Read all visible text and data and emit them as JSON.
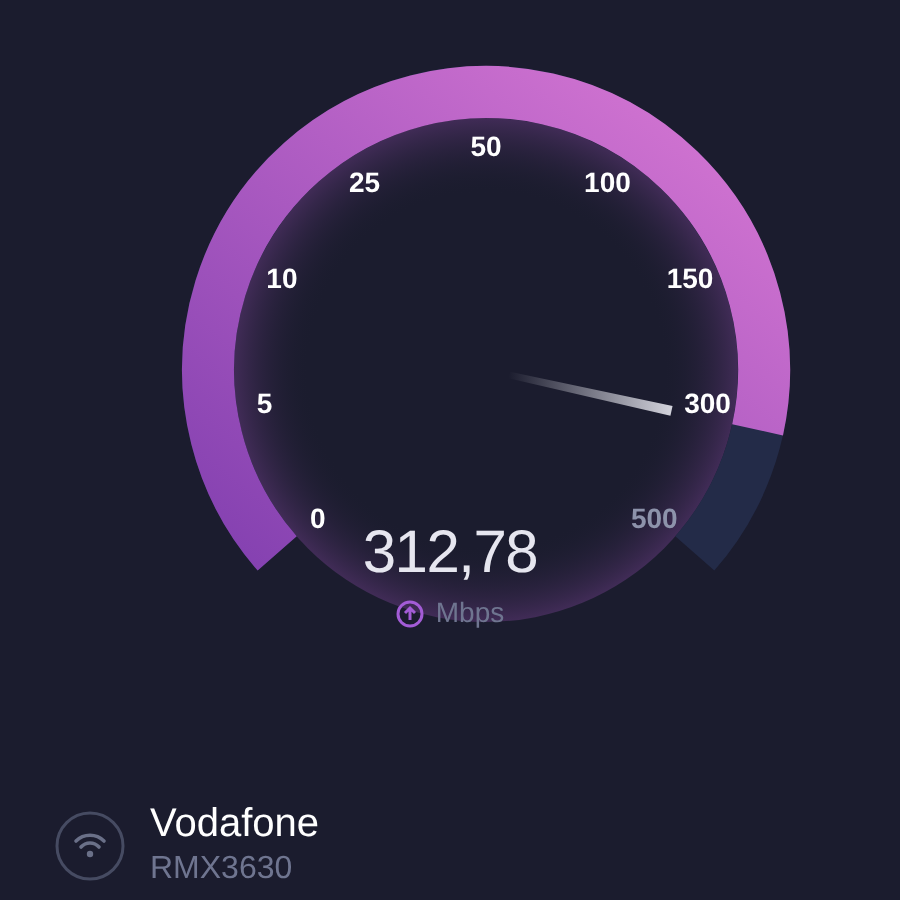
{
  "gauge": {
    "ticks": [
      "0",
      "5",
      "10",
      "25",
      "50",
      "100",
      "150",
      "300",
      "500"
    ]
  },
  "reading": {
    "value": "312,78",
    "unit": "Mbps"
  },
  "network": {
    "name": "Vodafone",
    "device": "RMX3630"
  }
}
